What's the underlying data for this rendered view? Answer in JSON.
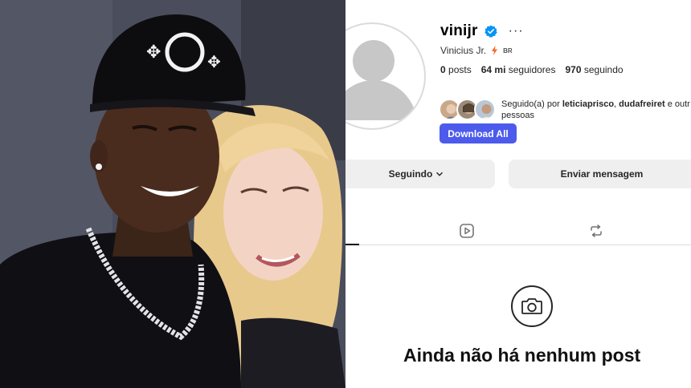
{
  "profile": {
    "username": "vinijr",
    "full_name": "Vinicius Jr.",
    "country_code": "BR",
    "stats": {
      "posts_value": "0",
      "posts_label": "posts",
      "followers_value": "64 mi",
      "followers_label": "seguidores",
      "following_value": "970",
      "following_label": "seguindo"
    },
    "followed_by": {
      "prefix": "Seguido(a) por",
      "user1": "leticiaprisco",
      "separator": ",",
      "user2": "dudafreiret",
      "suffix": "e outr",
      "suffix2": "pessoas"
    }
  },
  "actions": {
    "download_label": "Download All",
    "following_label": "Seguindo",
    "message_label": "Enviar mensagem"
  },
  "empty_state": {
    "title": "Ainda não há nenhum post"
  },
  "icons": {
    "verified": "verified-badge-icon",
    "more": "more-options-icon",
    "bolt": "bolt-icon",
    "chevron": "chevron-down-icon",
    "reels_tab": "reels-icon",
    "reposts_tab": "repost-icon",
    "empty": "camera-icon"
  },
  "colors": {
    "accent_blue": "#4c5bec",
    "verified_blue": "#0095f6",
    "button_gray": "#efefef",
    "bolt_orange": "#f26a2e"
  }
}
